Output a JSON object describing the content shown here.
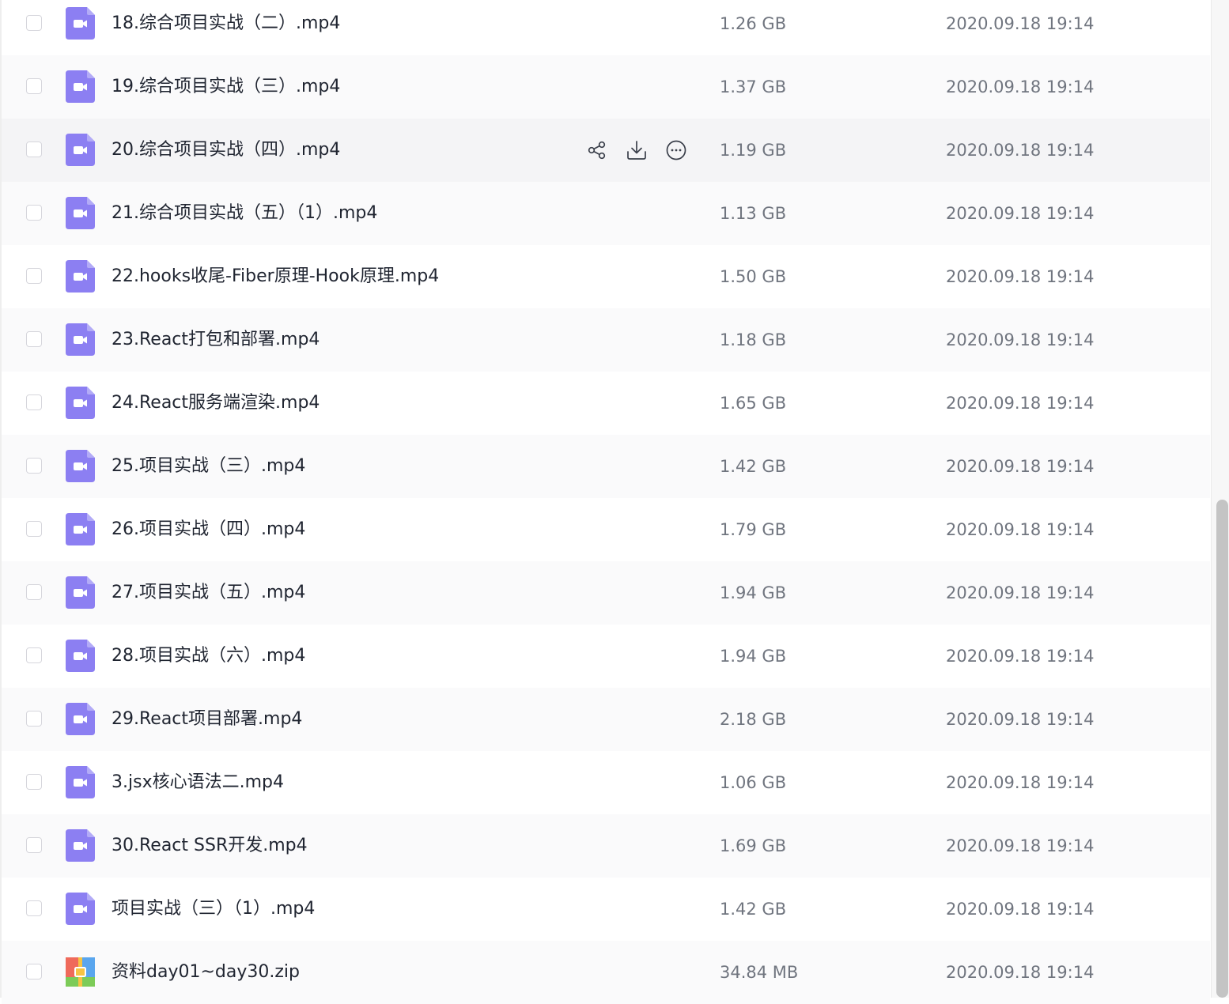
{
  "colors": {
    "video_icon": "#8c7ff2",
    "text_primary": "#1f2430",
    "text_secondary": "#70757f"
  },
  "row_actions": {
    "share_icon": "share-icon",
    "download_icon": "download-icon",
    "more_icon": "more-icon"
  },
  "files": [
    {
      "name": "18.综合项目实战（二）.mp4",
      "size": "1.26 GB",
      "date": "2020.09.18 19:14",
      "type": "video"
    },
    {
      "name": "19.综合项目实战（三）.mp4",
      "size": "1.37 GB",
      "date": "2020.09.18 19:14",
      "type": "video"
    },
    {
      "name": "20.综合项目实战（四）.mp4",
      "size": "1.19 GB",
      "date": "2020.09.18 19:14",
      "type": "video"
    },
    {
      "name": "21.综合项目实战（五）（1）.mp4",
      "size": "1.13 GB",
      "date": "2020.09.18 19:14",
      "type": "video"
    },
    {
      "name": "22.hooks收尾-Fiber原理-Hook原理.mp4",
      "size": "1.50 GB",
      "date": "2020.09.18 19:14",
      "type": "video"
    },
    {
      "name": "23.React打包和部署.mp4",
      "size": "1.18 GB",
      "date": "2020.09.18 19:14",
      "type": "video"
    },
    {
      "name": "24.React服务端渲染.mp4",
      "size": "1.65 GB",
      "date": "2020.09.18 19:14",
      "type": "video"
    },
    {
      "name": "25.项目实战（三）.mp4",
      "size": "1.42 GB",
      "date": "2020.09.18 19:14",
      "type": "video"
    },
    {
      "name": "26.项目实战（四）.mp4",
      "size": "1.79 GB",
      "date": "2020.09.18 19:14",
      "type": "video"
    },
    {
      "name": "27.项目实战（五）.mp4",
      "size": "1.94 GB",
      "date": "2020.09.18 19:14",
      "type": "video"
    },
    {
      "name": "28.项目实战（六）.mp4",
      "size": "1.94 GB",
      "date": "2020.09.18 19:14",
      "type": "video"
    },
    {
      "name": "29.React项目部署.mp4",
      "size": "2.18 GB",
      "date": "2020.09.18 19:14",
      "type": "video"
    },
    {
      "name": "3.jsx核心语法二.mp4",
      "size": "1.06 GB",
      "date": "2020.09.18 19:14",
      "type": "video"
    },
    {
      "name": "30.React SSR开发.mp4",
      "size": "1.69 GB",
      "date": "2020.09.18 19:14",
      "type": "video"
    },
    {
      "name": "项目实战（三）（1）.mp4",
      "size": "1.42 GB",
      "date": "2020.09.18 19:14",
      "type": "video"
    },
    {
      "name": "资料day01~day30.zip",
      "size": "34.84 MB",
      "date": "2020.09.18 19:14",
      "type": "zip"
    }
  ]
}
